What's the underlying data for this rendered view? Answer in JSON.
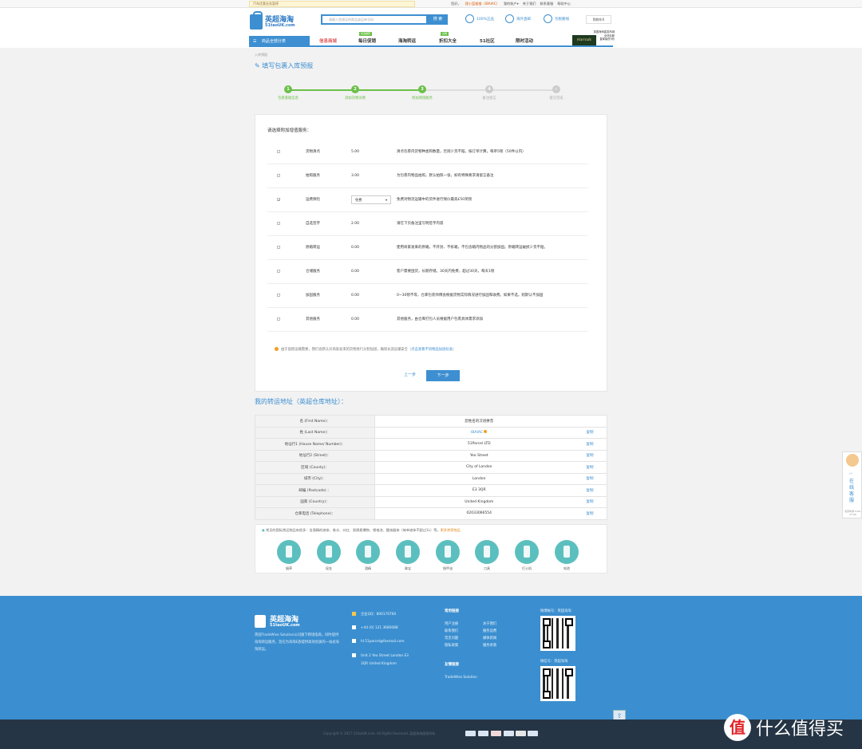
{
  "topbar": {
    "notice": "汽车优惠业务暂停",
    "greeting": "您好，",
    "username": "我小蓝猴猴（IBAIAC）",
    "links": [
      "我的账户▾",
      "关于我们",
      "联系客服",
      "帮助中心"
    ]
  },
  "header": {
    "logo_cn": "英超海淘",
    "logo_en": "51taoUK.com",
    "search_placeholder": "请输入您想买的商品或运单号码",
    "search_button": "搜 索",
    "features": [
      "100%正品",
      "海外直邮",
      "包税路线"
    ],
    "cart": "购物车0"
  },
  "nav": {
    "category": "商品全部分类",
    "items": [
      "信息商城",
      "每日促销",
      "海淘转运",
      "折扣大全",
      "51社区",
      "限时活动"
    ],
    "tags": [
      "优选推荐",
      "全网"
    ],
    "harrods_title": "英国海淘直发商城",
    "harrods_sub1": "全场包邮",
    "harrods_sub2": "直邮最低9折",
    "harrods_brand": "Harrods"
  },
  "breadcrumb": "入库预报",
  "page_title": "填写包裹入库预报",
  "steps": [
    {
      "num": "1",
      "label": "包裹基础信息",
      "state": "done"
    },
    {
      "num": "2",
      "label": "添加货物详情",
      "state": "done"
    },
    {
      "num": "3",
      "label": "附加增值服务",
      "state": "active"
    },
    {
      "num": "4",
      "label": "备注留言",
      "state": "todo"
    },
    {
      "num": "✓",
      "label": "提交完成",
      "state": "todo"
    }
  ],
  "services_title": "请选择附加增值服务：",
  "services": [
    {
      "checked": false,
      "name": "货物清点",
      "price": "5.00",
      "desc": "清点包裹内货物种类和数量，否则少货不赔。按订单计算，每单5镑（50件以内）"
    },
    {
      "checked": false,
      "name": "拍照服务",
      "price": "3.00",
      "desc": "为包裹内物品拍照，默认拍照一张，如有特殊要求请留言备注"
    },
    {
      "checked": true,
      "name": "运费保险",
      "select": "免费",
      "desc": "免费对物流运输中的货件进行保价最高£50英镑"
    },
    {
      "checked": false,
      "name": "自选签字",
      "price": "2.00",
      "desc": "请在下页备注里写明签字内容"
    },
    {
      "checked": false,
      "name": "原箱转运",
      "price": "0.00",
      "desc": "使用商家发来的原箱，不开封、不拆箱，不包含箱内物品的分割加固。原箱转运破损少货不赔。"
    },
    {
      "checked": false,
      "name": "仓储服务",
      "price": "0.00",
      "desc": "客户需要囤货，长期存储。30天内免费，超过30天，每天1镑"
    },
    {
      "checked": false,
      "name": "加固服务",
      "price": "0.00",
      "desc": "0~30镑不等，仓库包装师傅会根据货物实际情况进行加固和收费。如果不选，则默认不加固"
    },
    {
      "checked": false,
      "name": "其他服务",
      "price": "0.00",
      "desc": "其他服务，由仓库打包人员根据用户包裹具体需求添加"
    }
  ],
  "panel_note": "由于国际运输需要，我们会默认对商家发来的货物进行分割加固，确保长途运输安全（",
  "panel_note_link": "点击查看不同物品加固标准",
  "panel_note_end": "）",
  "prev_label": "上一步",
  "next_label": "下一步",
  "address_title": "我的转运地址（英超仓库地址）：",
  "address_rows": [
    {
      "key": "名 (First Name)：",
      "value": "您姓名的汉语拼音",
      "copy": ""
    },
    {
      "key": "姓 (Last Name)：",
      "value": "IBAIAC",
      "copy": "复制"
    },
    {
      "key": "地址行1 (House Name/ Number)：",
      "value": "51Parcel LTD",
      "copy": "复制"
    },
    {
      "key": "地址行2 (Street)：",
      "value": "Yeo Street",
      "copy": "复制"
    },
    {
      "key": "区域 (County)：",
      "value": "City of London",
      "copy": "复制"
    },
    {
      "key": "城市 (City)：",
      "value": "London",
      "copy": "复制"
    },
    {
      "key": "邮编 (Postcode) ：",
      "value": "E3 3QR",
      "copy": "复制"
    },
    {
      "key": "国家 (Country)：",
      "value": "United Kingdom",
      "copy": "复制"
    },
    {
      "key": "仓库电话 (Telephone)：",
      "value": "02033066554",
      "copy": "复制"
    }
  ],
  "banned_note": "常见的国际禁运物品有很多：含酒精的液体、香水、口红、易燃易爆物、锂电池、酸液器体（每单液体不超过1L）等。",
  "banned_link": "更多禁寄物品",
  "banned_items": [
    "烟草",
    "现金",
    "酒精",
    "珠宝",
    "指甲油",
    "刀具",
    "打火机",
    "电池"
  ],
  "side_service": {
    "text": "在线客服",
    "hours": "北京时间 9:00-17:00"
  },
  "footer": {
    "logo_cn": "英超海淘",
    "logo_en": "51taoUK.com",
    "desc": "英国TradeWise Solution公司旗下跨境电商，同时提供海淘转运服务，旨在为海淘E族提供高效优质的一站式海淘转运。",
    "qq": "企业QQ：800170760",
    "phone": "+44 (0) 121 3680088",
    "email": "hl.51parcel@foxmail.com",
    "address1": "Unit 2 Yeo Street London E3",
    "address2": "3QR United Kingdom",
    "links_head": "常用链接",
    "links_col1": [
      "用户注册",
      "联系我们",
      "常见问题",
      "隐私政策"
    ],
    "links_col2": [
      "关于我们",
      "服务运费",
      "媒体新闻",
      "服务条款"
    ],
    "friends_head": "友情链接",
    "friends": [
      "TradeWise Solution"
    ],
    "weibo": "微博帐号：英超海淘",
    "wechat": "微信号：英超海淘"
  },
  "copyright": "Copyright © 2017 51taoUK.com. All Rights Reserved. 英超海淘版权所有",
  "watermark": "什么值得买",
  "watermark_logo": "值",
  "colors": {
    "primary": "#3d8fd1",
    "step_done": "#6cc04a",
    "footer": "#3b8fd0",
    "bottom": "#253545"
  }
}
